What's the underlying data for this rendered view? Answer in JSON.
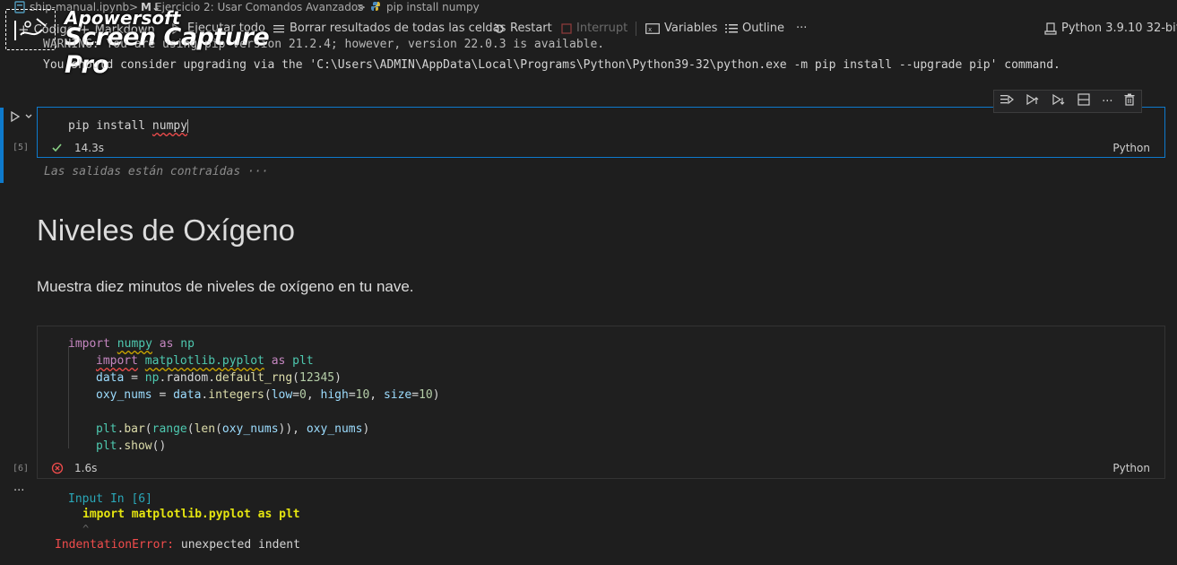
{
  "breadcrumb": {
    "file": "ship-manual.ipynb",
    "md_prefix": "M↓",
    "section": "Ejercicio 2: Usar Comandos Avanzados",
    "cell": "pip install numpy",
    "sep": ">"
  },
  "toolbar": {
    "code": "Código",
    "markdown": "Markdown",
    "run_all": "Ejecutar todo",
    "clear_outputs": "Borrar resultados de todas las celdas",
    "restart": "Restart",
    "interrupt": "Interrupt",
    "variables": "Variables",
    "outline": "Outline",
    "more": "···",
    "kernel": "Python 3.9.10 32-bit"
  },
  "watermark": {
    "line1": "Apowersoft",
    "line2": "Screen Capture Pro"
  },
  "output_top": {
    "line1": "WARNING: You are using pip version 21.2.4; however, version 22.0.3 is available.",
    "line2": "You should consider upgrading via the 'C:\\Users\\ADMIN\\AppData\\Local\\Programs\\Python\\Python39-32\\python.exe -m pip install --upgrade pip' command."
  },
  "cell5": {
    "count": "[5]",
    "code_a": "pip install ",
    "code_b": "numpy",
    "status_time": "14.3s",
    "language": "Python",
    "collapsed_outputs": "Las salidas están contraídas",
    "collapsed_ellipsis": "···"
  },
  "markdown_cell": {
    "title": "Niveles de Oxígeno",
    "paragraph": "Muestra diez minutos de niveles de oxígeno en tu nave."
  },
  "cell6": {
    "count": "[6]",
    "status_time": "1.6s",
    "language": "Python",
    "more": "···",
    "code": {
      "l1": {
        "k1": "import",
        "a": " ",
        "m": "numpy",
        "b": " ",
        "k2": "as",
        "c": " ",
        "n": "np"
      },
      "l2": {
        "k1": "import",
        "a": " ",
        "m": "matplotlib.pyplot",
        "b": " ",
        "k2": "as",
        "c": " ",
        "n": "plt"
      },
      "l3": {
        "a": "data",
        "b": " = ",
        "c": "np",
        "d": ".random.",
        "e": "default_rng",
        "f": "(",
        "g": "12345",
        "h": ")"
      },
      "l4": {
        "a": "oxy_nums",
        "b": " = ",
        "c": "data",
        "d": ".",
        "e": "integers",
        "f": "(",
        "g": "low",
        "h": "=",
        "i": "0",
        "j": ", ",
        "k": "high",
        "l": "=",
        "m": "10",
        "n": ", ",
        "o": "size",
        "p": "=",
        "q": "10",
        "r": ")"
      },
      "l6": {
        "a": "plt",
        "b": ".",
        "c": "bar",
        "d": "(",
        "e": "range",
        "f": "(",
        "g": "len",
        "h": "(",
        "i": "oxy_nums",
        "j": ")), ",
        "k": "oxy_nums",
        "l": ")"
      },
      "l7": {
        "a": "plt",
        "b": ".",
        "c": "show",
        "d": "()"
      }
    },
    "error": {
      "input_label": "Input In [6]",
      "code": "import matplotlib.pyplot as plt",
      "caret": "^",
      "error_name": "IndentationError:",
      "error_msg": " unexpected indent"
    }
  },
  "colors": {
    "accent": "#0e7acc",
    "success": "#89d185",
    "error": "#f14c4c"
  }
}
